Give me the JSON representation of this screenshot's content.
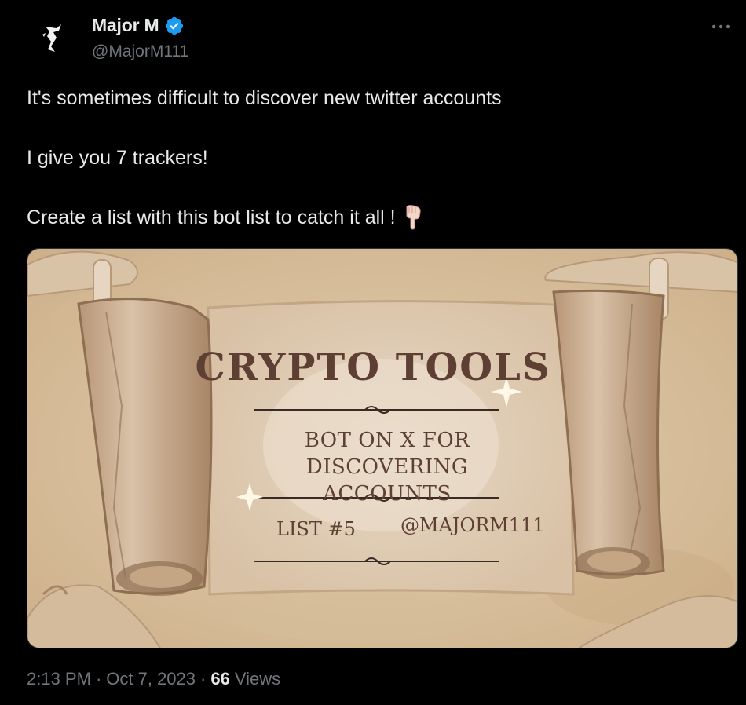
{
  "author": {
    "display_name": "Major M",
    "handle": "@MajorM111",
    "verified": true,
    "avatar_icon": "flame-figure-icon"
  },
  "tweet": {
    "lines": [
      "It's sometimes difficult to discover new twitter accounts",
      "I give you 7 trackers!",
      "Create a list with this bot list to catch it all !"
    ],
    "emoji": "pointing-down-hand-icon"
  },
  "media": {
    "title": "CRYPTO TOOLS",
    "subtitle": "BOT ON X FOR DISCOVERING ACCOUNTS",
    "list_label": "LIST #5",
    "handle_label": "@MAJORM111"
  },
  "meta": {
    "time": "2:13 PM",
    "date": "Oct 7, 2023",
    "views_count": "66",
    "views_label": "Views"
  },
  "colors": {
    "background": "#000000",
    "text_primary": "#e7e9ea",
    "text_secondary": "#71767b",
    "verified_blue": "#1d9bf0",
    "parchment": "#e3d2bd",
    "ink": "#5e3f33"
  }
}
